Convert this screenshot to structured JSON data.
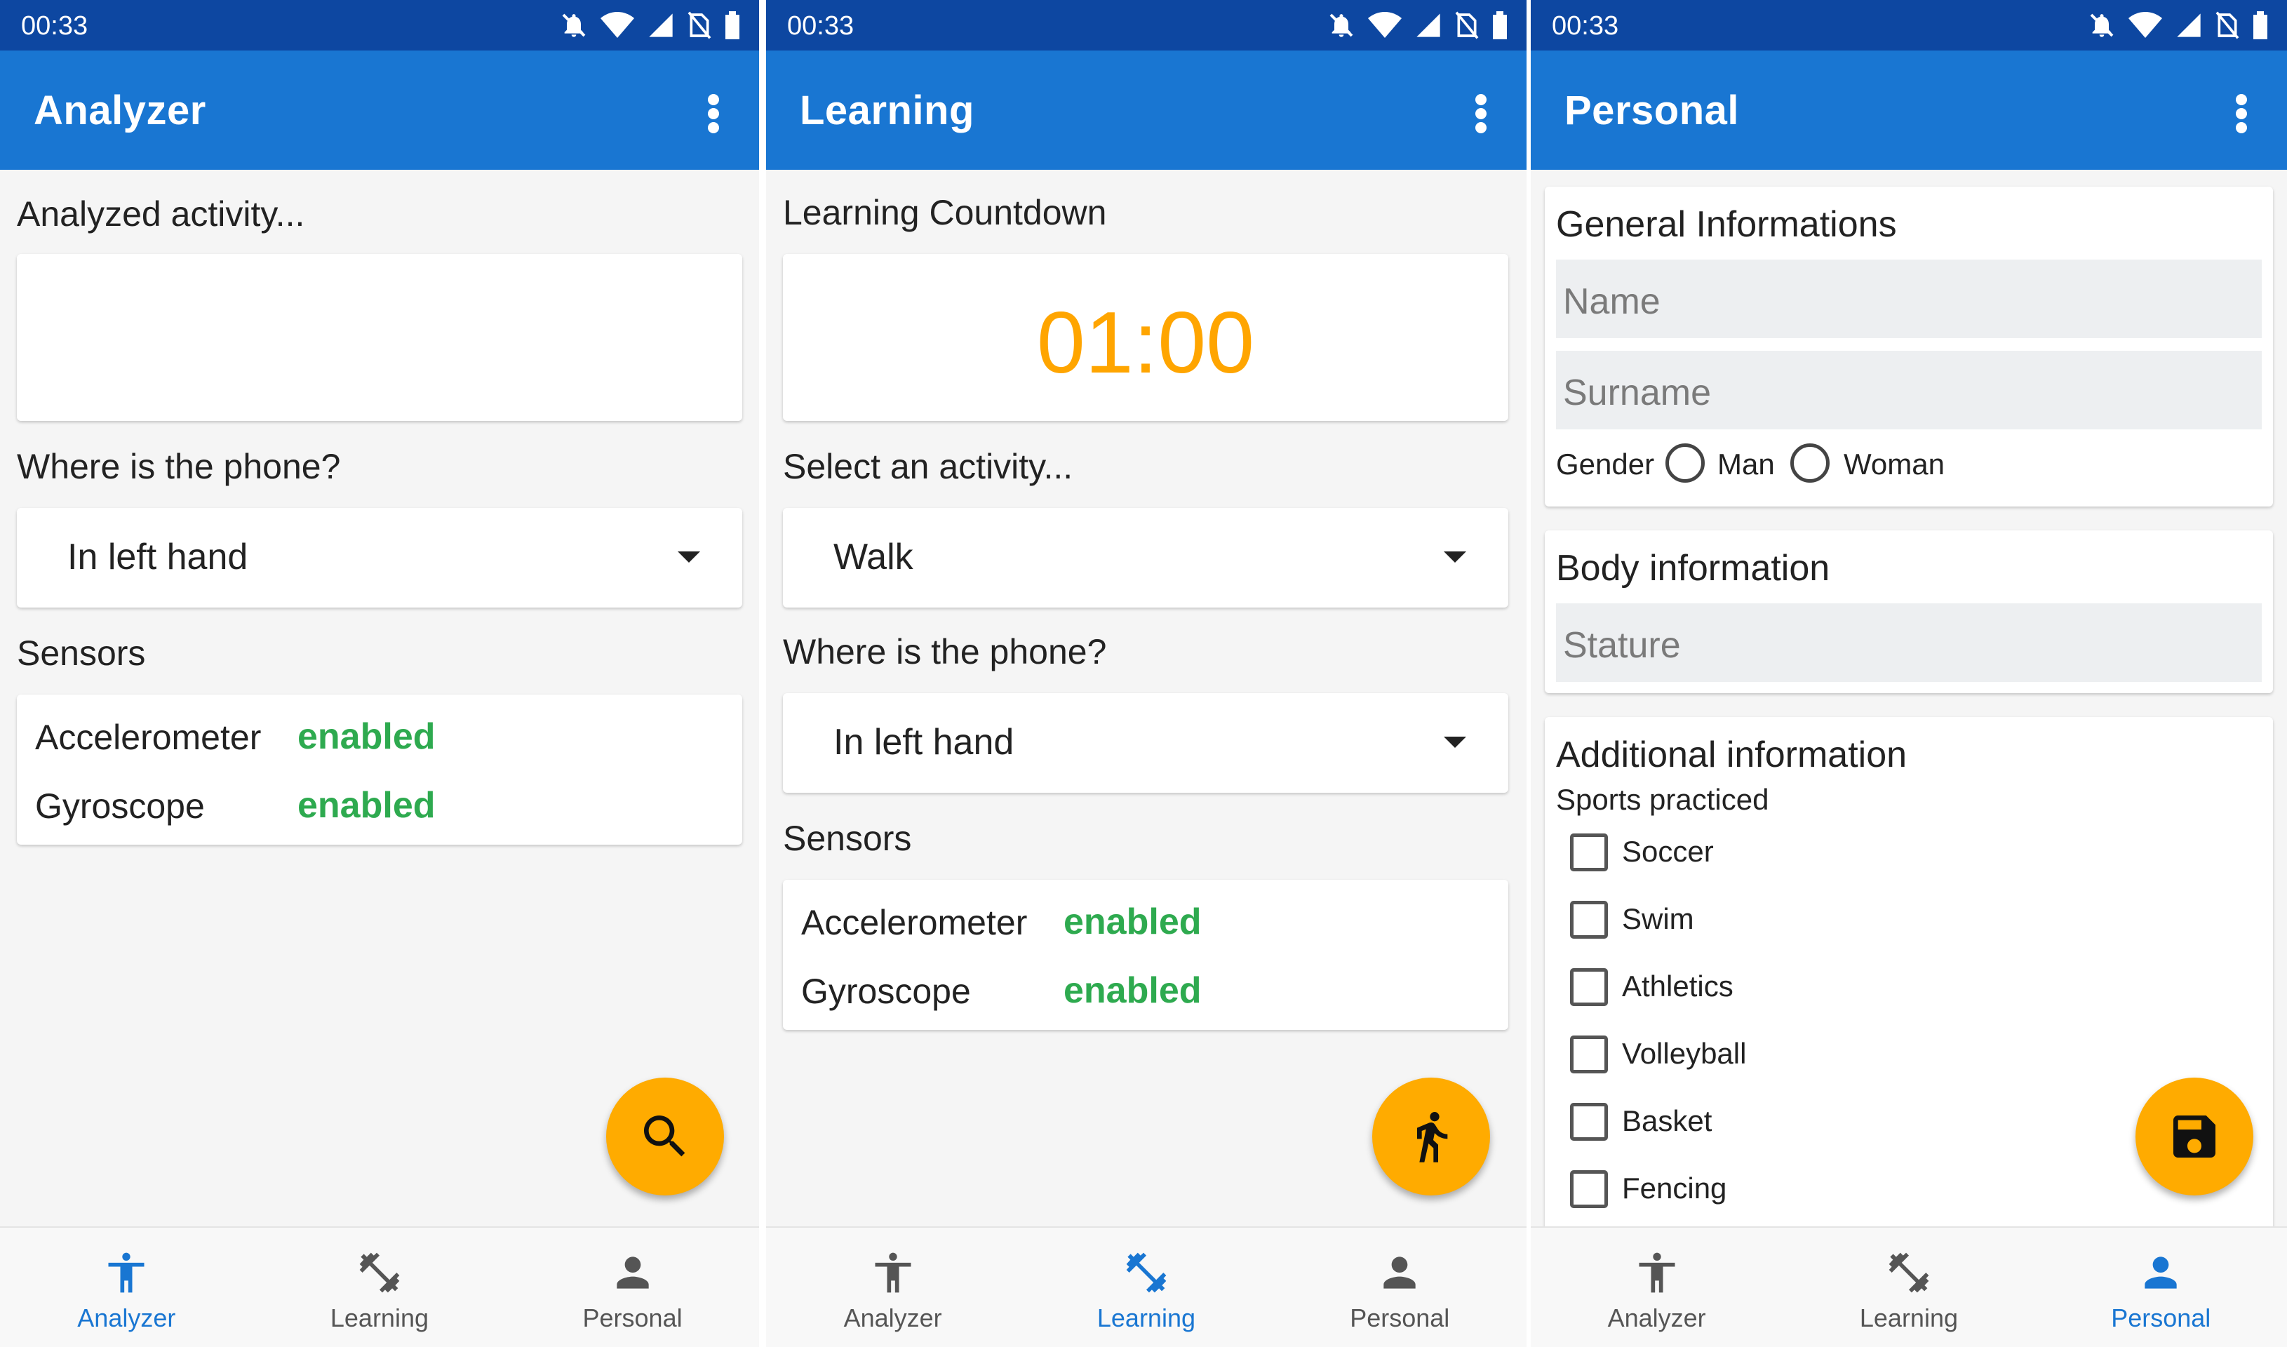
{
  "status_time": "00:33",
  "analyzer": {
    "title": "Analyzer",
    "analyzed_label": "Analyzed activity...",
    "analyzed_value": "",
    "where_label": "Where is the phone?",
    "where_value": "In left hand",
    "sensors_label": "Sensors",
    "sensors": [
      {
        "name": "Accelerometer",
        "state": "enabled"
      },
      {
        "name": "Gyroscope",
        "state": "enabled"
      }
    ]
  },
  "learning": {
    "title": "Learning",
    "countdown_label": "Learning Countdown",
    "countdown_value": "01:00",
    "activity_label": "Select an activity...",
    "activity_value": "Walk",
    "where_label": "Where is the phone?",
    "where_value": "In left hand",
    "sensors_label": "Sensors",
    "sensors": [
      {
        "name": "Accelerometer",
        "state": "enabled"
      },
      {
        "name": "Gyroscope",
        "state": "enabled"
      }
    ]
  },
  "personal": {
    "title": "Personal",
    "general_title": "General Informations",
    "name_placeholder": "Name",
    "surname_placeholder": "Surname",
    "gender_label": "Gender",
    "gender_options": [
      "Man",
      "Woman"
    ],
    "body_title": "Body information",
    "stature_placeholder": "Stature",
    "additional_title": "Additional information",
    "sports_label": "Sports practiced",
    "sports": [
      "Soccer",
      "Swim",
      "Athletics",
      "Volleyball",
      "Basket",
      "Fencing"
    ]
  },
  "nav": {
    "analyzer": "Analyzer",
    "learning": "Learning",
    "personal": "Personal"
  },
  "colors": {
    "status_bar": "#0d47a1",
    "app_bar": "#1976d2",
    "accent": "#ffab00",
    "enabled": "#2eaa4f",
    "timer": "#ffa500"
  },
  "icons": {
    "fab_analyzer": "search-icon",
    "fab_learning": "run-icon",
    "fab_personal": "save-icon",
    "nav_analyzer": "accessibility-icon",
    "nav_learning": "dumbbell-icon",
    "nav_personal": "person-icon"
  }
}
